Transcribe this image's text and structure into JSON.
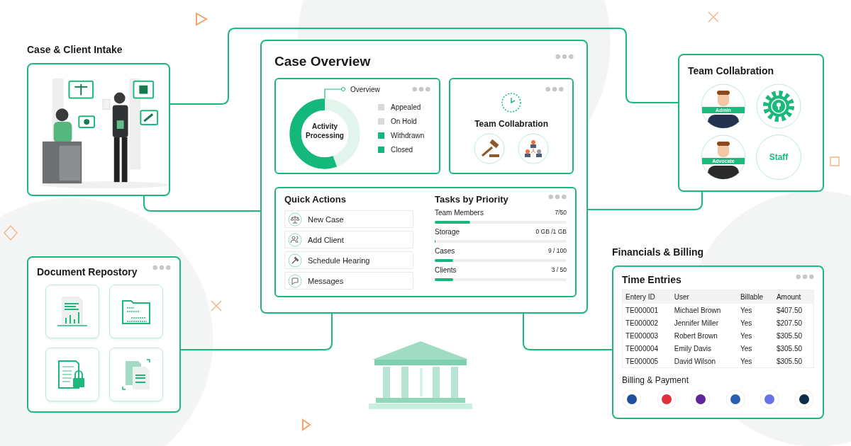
{
  "intake": {
    "title": "Case & Client Intake"
  },
  "overview": {
    "title": "Case Overview",
    "status": {
      "label": "Overview",
      "center_label": "Activity Processing",
      "legend": [
        {
          "label": "Appealed",
          "color": "#d9d9d9"
        },
        {
          "label": "On Hold",
          "color": "#d9d9d9"
        },
        {
          "label": "Withdrawn",
          "color": "#14b87a"
        },
        {
          "label": "Closed",
          "color": "#14b87a"
        }
      ]
    },
    "team": {
      "title": "Team Collabration"
    },
    "quick_actions": {
      "title": "Quick Actions",
      "items": [
        {
          "label": "New Case",
          "kind": "scale"
        },
        {
          "label": "Add Client",
          "kind": "users"
        },
        {
          "label": "Schedule Hearing",
          "kind": "gavel"
        },
        {
          "label": "Messages",
          "kind": "message"
        }
      ]
    },
    "tasks": {
      "title": "Tasks by Priority",
      "items": [
        {
          "label": "Team Members",
          "reading": "7/50",
          "level": 0.27
        },
        {
          "label": "Storage",
          "reading": "0 GB /1 GB",
          "level": 0
        },
        {
          "label": "Cases",
          "reading": "9 / 100",
          "level": 0.14
        },
        {
          "label": "Clients",
          "reading": "3 / 50",
          "level": 0.14
        }
      ]
    }
  },
  "team_collaboration": {
    "title": "Team Collabration",
    "members": [
      {
        "kind": "avatar",
        "label": "Admin"
      },
      {
        "kind": "gear"
      },
      {
        "kind": "avatar",
        "label": "Advocate"
      },
      {
        "kind": "text",
        "label": "Staff"
      }
    ]
  },
  "documents": {
    "title": "Document Repostory",
    "tiles": [
      {
        "kind": "report"
      },
      {
        "kind": "folder"
      },
      {
        "kind": "locked"
      },
      {
        "kind": "copy"
      }
    ]
  },
  "financials": {
    "heading": "Financials & Billing",
    "title": "Time Entries",
    "table": {
      "columns": [
        "Entery ID",
        "User",
        "Billable",
        "Amount"
      ],
      "rows": [
        [
          "TE000001",
          "Michael Brown",
          "Yes",
          "$407.50"
        ],
        [
          "TE000002",
          "Jennifer Miller",
          "Yes",
          "$207.50"
        ],
        [
          "TE000003",
          "Robert Brown",
          "Yes",
          "$305.50"
        ],
        [
          "TE000004",
          "Emily Davis",
          "Yes",
          "$305.50"
        ],
        [
          "TE000005",
          "David Wilson",
          "Yes",
          "$305.50"
        ]
      ]
    },
    "billing_title": "Billing & Payment",
    "payments": [
      {
        "color": "#1f4e9c"
      },
      {
        "color": "#e0303a"
      },
      {
        "color": "#5f259f"
      },
      {
        "color": "#2b5fb0"
      },
      {
        "color": "#6772e5"
      },
      {
        "color": "#0b2e4a"
      }
    ]
  }
}
